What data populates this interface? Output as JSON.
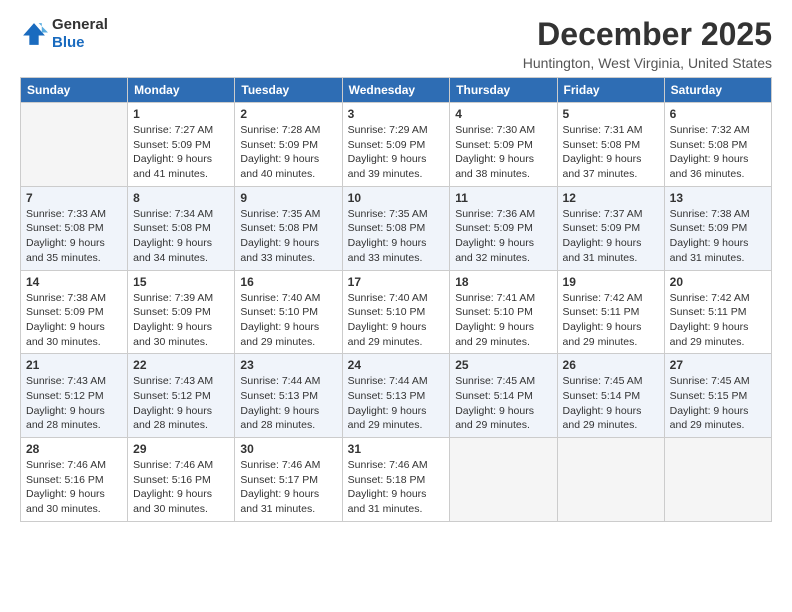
{
  "logo": {
    "line1": "General",
    "line2": "Blue"
  },
  "title": "December 2025",
  "subtitle": "Huntington, West Virginia, United States",
  "days_of_week": [
    "Sunday",
    "Monday",
    "Tuesday",
    "Wednesday",
    "Thursday",
    "Friday",
    "Saturday"
  ],
  "weeks": [
    [
      {
        "day": "",
        "info": ""
      },
      {
        "day": "1",
        "info": "Sunrise: 7:27 AM\nSunset: 5:09 PM\nDaylight: 9 hours\nand 41 minutes."
      },
      {
        "day": "2",
        "info": "Sunrise: 7:28 AM\nSunset: 5:09 PM\nDaylight: 9 hours\nand 40 minutes."
      },
      {
        "day": "3",
        "info": "Sunrise: 7:29 AM\nSunset: 5:09 PM\nDaylight: 9 hours\nand 39 minutes."
      },
      {
        "day": "4",
        "info": "Sunrise: 7:30 AM\nSunset: 5:09 PM\nDaylight: 9 hours\nand 38 minutes."
      },
      {
        "day": "5",
        "info": "Sunrise: 7:31 AM\nSunset: 5:08 PM\nDaylight: 9 hours\nand 37 minutes."
      },
      {
        "day": "6",
        "info": "Sunrise: 7:32 AM\nSunset: 5:08 PM\nDaylight: 9 hours\nand 36 minutes."
      }
    ],
    [
      {
        "day": "7",
        "info": "Sunrise: 7:33 AM\nSunset: 5:08 PM\nDaylight: 9 hours\nand 35 minutes."
      },
      {
        "day": "8",
        "info": "Sunrise: 7:34 AM\nSunset: 5:08 PM\nDaylight: 9 hours\nand 34 minutes."
      },
      {
        "day": "9",
        "info": "Sunrise: 7:35 AM\nSunset: 5:08 PM\nDaylight: 9 hours\nand 33 minutes."
      },
      {
        "day": "10",
        "info": "Sunrise: 7:35 AM\nSunset: 5:08 PM\nDaylight: 9 hours\nand 33 minutes."
      },
      {
        "day": "11",
        "info": "Sunrise: 7:36 AM\nSunset: 5:09 PM\nDaylight: 9 hours\nand 32 minutes."
      },
      {
        "day": "12",
        "info": "Sunrise: 7:37 AM\nSunset: 5:09 PM\nDaylight: 9 hours\nand 31 minutes."
      },
      {
        "day": "13",
        "info": "Sunrise: 7:38 AM\nSunset: 5:09 PM\nDaylight: 9 hours\nand 31 minutes."
      }
    ],
    [
      {
        "day": "14",
        "info": "Sunrise: 7:38 AM\nSunset: 5:09 PM\nDaylight: 9 hours\nand 30 minutes."
      },
      {
        "day": "15",
        "info": "Sunrise: 7:39 AM\nSunset: 5:09 PM\nDaylight: 9 hours\nand 30 minutes."
      },
      {
        "day": "16",
        "info": "Sunrise: 7:40 AM\nSunset: 5:10 PM\nDaylight: 9 hours\nand 29 minutes."
      },
      {
        "day": "17",
        "info": "Sunrise: 7:40 AM\nSunset: 5:10 PM\nDaylight: 9 hours\nand 29 minutes."
      },
      {
        "day": "18",
        "info": "Sunrise: 7:41 AM\nSunset: 5:10 PM\nDaylight: 9 hours\nand 29 minutes."
      },
      {
        "day": "19",
        "info": "Sunrise: 7:42 AM\nSunset: 5:11 PM\nDaylight: 9 hours\nand 29 minutes."
      },
      {
        "day": "20",
        "info": "Sunrise: 7:42 AM\nSunset: 5:11 PM\nDaylight: 9 hours\nand 29 minutes."
      }
    ],
    [
      {
        "day": "21",
        "info": "Sunrise: 7:43 AM\nSunset: 5:12 PM\nDaylight: 9 hours\nand 28 minutes."
      },
      {
        "day": "22",
        "info": "Sunrise: 7:43 AM\nSunset: 5:12 PM\nDaylight: 9 hours\nand 28 minutes."
      },
      {
        "day": "23",
        "info": "Sunrise: 7:44 AM\nSunset: 5:13 PM\nDaylight: 9 hours\nand 28 minutes."
      },
      {
        "day": "24",
        "info": "Sunrise: 7:44 AM\nSunset: 5:13 PM\nDaylight: 9 hours\nand 29 minutes."
      },
      {
        "day": "25",
        "info": "Sunrise: 7:45 AM\nSunset: 5:14 PM\nDaylight: 9 hours\nand 29 minutes."
      },
      {
        "day": "26",
        "info": "Sunrise: 7:45 AM\nSunset: 5:14 PM\nDaylight: 9 hours\nand 29 minutes."
      },
      {
        "day": "27",
        "info": "Sunrise: 7:45 AM\nSunset: 5:15 PM\nDaylight: 9 hours\nand 29 minutes."
      }
    ],
    [
      {
        "day": "28",
        "info": "Sunrise: 7:46 AM\nSunset: 5:16 PM\nDaylight: 9 hours\nand 30 minutes."
      },
      {
        "day": "29",
        "info": "Sunrise: 7:46 AM\nSunset: 5:16 PM\nDaylight: 9 hours\nand 30 minutes."
      },
      {
        "day": "30",
        "info": "Sunrise: 7:46 AM\nSunset: 5:17 PM\nDaylight: 9 hours\nand 31 minutes."
      },
      {
        "day": "31",
        "info": "Sunrise: 7:46 AM\nSunset: 5:18 PM\nDaylight: 9 hours\nand 31 minutes."
      },
      {
        "day": "",
        "info": ""
      },
      {
        "day": "",
        "info": ""
      },
      {
        "day": "",
        "info": ""
      }
    ]
  ]
}
